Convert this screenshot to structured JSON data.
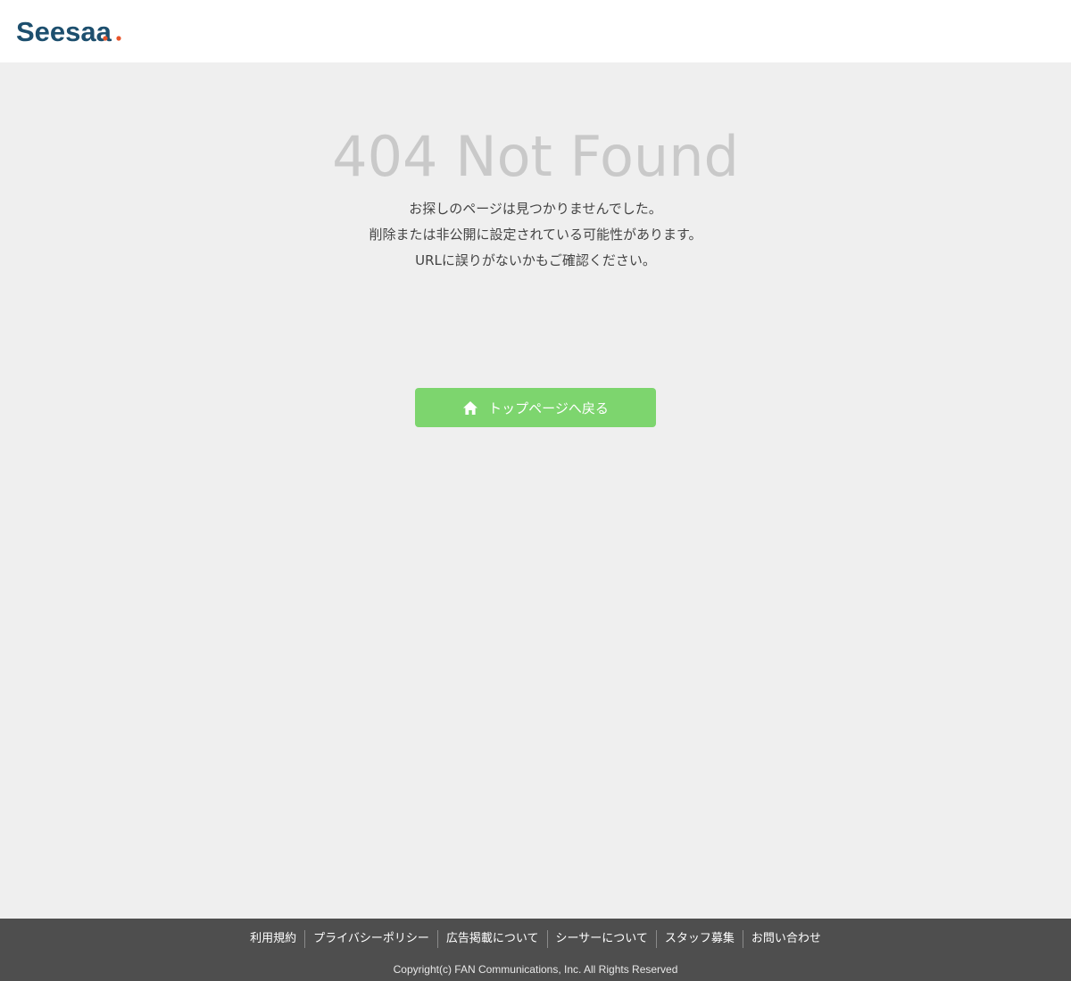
{
  "header": {
    "logo_text": "Seesaa"
  },
  "main": {
    "title": "404 Not Found",
    "messages": [
      "お探しのページは見つかりませんでした。",
      "削除または非公開に設定されている可能性があります。",
      "URLに誤りがないかもご確認ください。"
    ],
    "home_button": {
      "label": "トップページへ戻る",
      "icon": "home-icon"
    }
  },
  "footer": {
    "links": [
      "利用規約",
      "プライバシーポリシー",
      "広告掲載について",
      "シーサーについて",
      "スタッフ募集",
      "お問い合わせ"
    ],
    "copyright": "Copyright(c) FAN Communications, Inc. All Rights Reserved"
  },
  "colors": {
    "background": "#efefef",
    "logo": "#1d4f6e",
    "logo_accent": "#e8542a",
    "button": "#7dd56e",
    "footer": "#4e4e4e",
    "title": "#c9c9c9"
  }
}
